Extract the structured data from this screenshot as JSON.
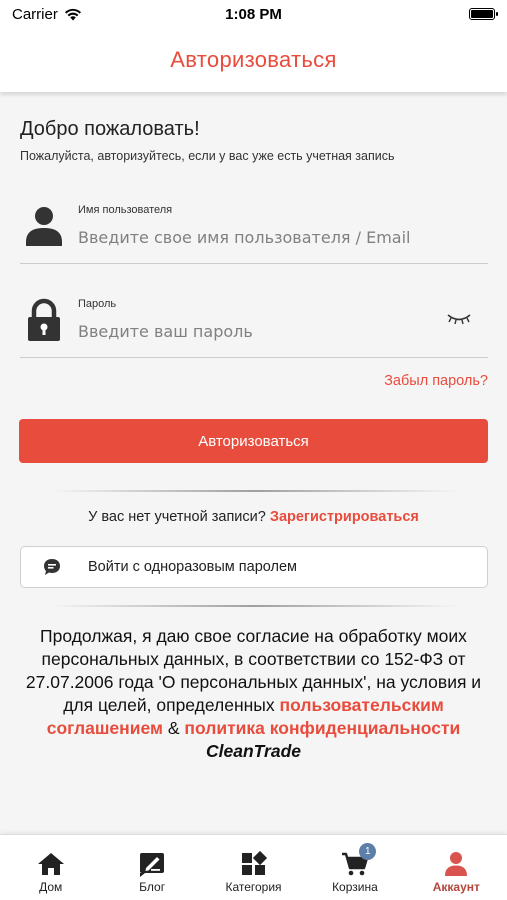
{
  "status_bar": {
    "carrier": "Carrier",
    "time": "1:08 PM"
  },
  "header": {
    "title": "Авторизоваться"
  },
  "login": {
    "welcome": "Добро пожаловать!",
    "subtitle": "Пожалуйста, авторизуйтесь, если у вас уже есть учетная запись",
    "username": {
      "label": "Имя пользователя",
      "placeholder": "Введите свое имя пользователя / Email",
      "value": ""
    },
    "password": {
      "label": "Пароль",
      "placeholder": "Введите ваш пароль",
      "value": ""
    },
    "forgot_password": "Забыл пароль?",
    "submit_label": "Авторизоваться",
    "no_account_text": "У вас нет учетной записи?",
    "register_link": "Зарегистрироваться",
    "otp_button_label": "Войти с одноразовым паролем"
  },
  "consent": {
    "text": "Продолжая, я даю свое согласие на обработку моих персональных данных, в соответствии со 152-ФЗ от 27.07.2006 года 'О персональных данных', на условия и для целей, определенных",
    "terms_link": "пользовательским соглашением",
    "amp": "&",
    "privacy_link": "политика конфиденциальности",
    "brand": "CleanTrade"
  },
  "tabs": [
    {
      "label": "Дом",
      "icon": "home-icon",
      "active": false
    },
    {
      "label": "Блог",
      "icon": "blog-edit-icon",
      "active": false
    },
    {
      "label": "Категория",
      "icon": "category-grid-icon",
      "active": false
    },
    {
      "label": "Корзина",
      "icon": "cart-icon",
      "active": false,
      "badge": "1"
    },
    {
      "label": "Аккаунт",
      "icon": "account-icon",
      "active": true
    }
  ],
  "colors": {
    "accent": "#e84c3d",
    "active_tab": "#b3473e",
    "badge": "#5b7fa8",
    "background": "#f5f5f5"
  }
}
